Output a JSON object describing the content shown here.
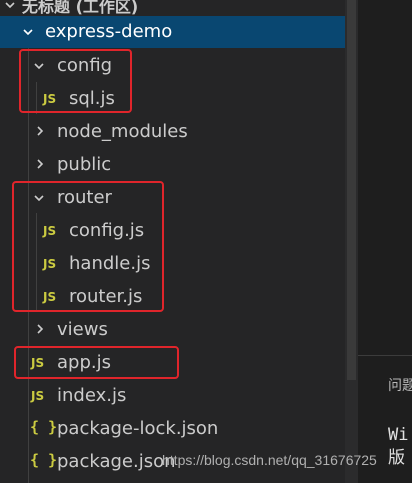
{
  "explorer": {
    "workspace_title": "无标题 (工作区)",
    "root_folder": "express-demo",
    "items": [
      {
        "label": "config",
        "type": "folder",
        "expanded": true
      },
      {
        "label": "sql.js",
        "type": "js-file"
      },
      {
        "label": "node_modules",
        "type": "folder",
        "expanded": false
      },
      {
        "label": "public",
        "type": "folder",
        "expanded": false
      },
      {
        "label": "router",
        "type": "folder",
        "expanded": true
      },
      {
        "label": "config.js",
        "type": "js-file"
      },
      {
        "label": "handle.js",
        "type": "js-file"
      },
      {
        "label": "router.js",
        "type": "js-file"
      },
      {
        "label": "views",
        "type": "folder",
        "expanded": false
      },
      {
        "label": "app.js",
        "type": "js-file"
      },
      {
        "label": "index.js",
        "type": "js-file"
      },
      {
        "label": "package-lock.json",
        "type": "json-file"
      },
      {
        "label": "package.json",
        "type": "json-file"
      }
    ],
    "js_icon_text": "JS",
    "json_icon_text": "{ }"
  },
  "panel": {
    "tab_label": "问题",
    "line1": "Wi",
    "line2": "版"
  },
  "watermark": "https://blog.csdn.net/qq_31676725",
  "colors": {
    "sidebar_bg": "#252526",
    "selected_bg": "#094771",
    "js_icon": "#cbcb41",
    "highlight_box": "#e0252b"
  }
}
